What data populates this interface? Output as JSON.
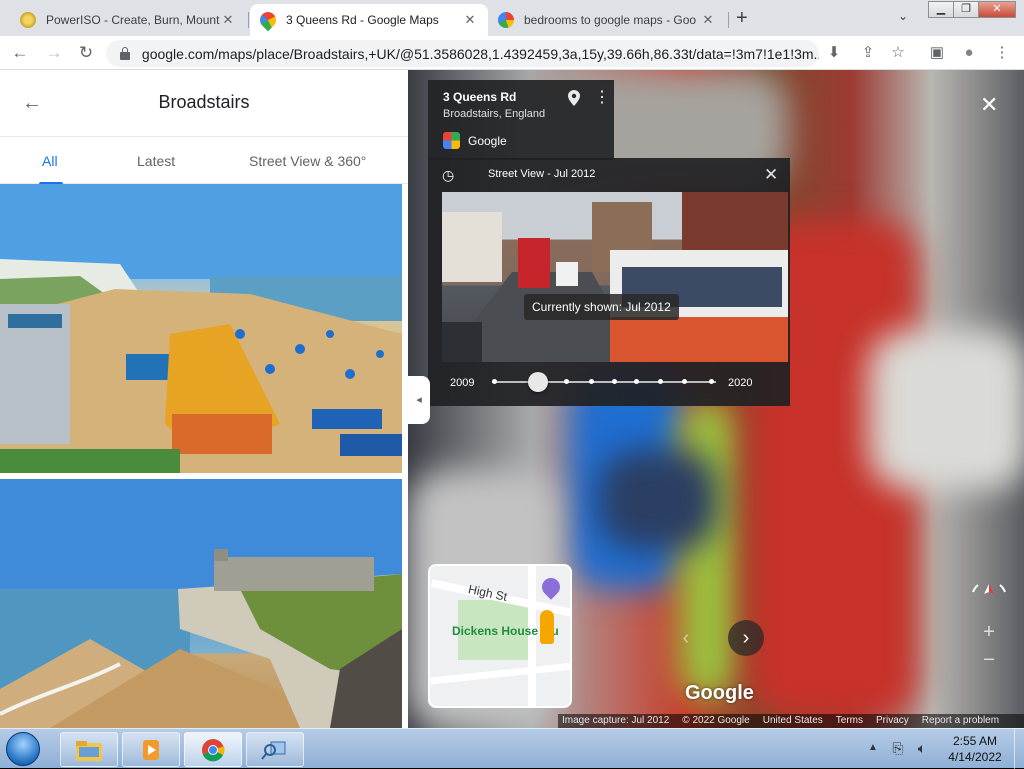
{
  "browser": {
    "tabs": [
      {
        "title": "PowerISO - Create, Burn, Mount,",
        "close": "✕"
      },
      {
        "title": "3 Queens Rd - Google Maps",
        "close": "✕"
      },
      {
        "title": "bedrooms to google maps - Goo",
        "close": "✕"
      }
    ],
    "new_tab": "+",
    "tab_menu": "⌄",
    "window_buttons": {
      "minimize": "▁",
      "maximize": "❐",
      "close": "✕"
    },
    "nav": {
      "back": "←",
      "forward": "→",
      "reload": "↻"
    },
    "url": "google.com/maps/place/Broadstairs,+UK/@51.3586028,1.4392459,3a,15y,39.66h,86.33t/data=!3m7!1e1!3m...",
    "toolbar_icons": {
      "install": "⬇",
      "share": "⇪",
      "bookmark": "☆",
      "sidepanel": "▣",
      "profile": "●",
      "menu": "⋮"
    }
  },
  "sidebar": {
    "back_icon": "←",
    "title": "Broadstairs",
    "tabs": [
      {
        "label": "All"
      },
      {
        "label": "Latest"
      },
      {
        "label": "Street View & 360°"
      }
    ]
  },
  "streetview": {
    "street": "3 Queens Rd",
    "locality": "Broadstairs, England",
    "brand": "Google",
    "close_icon": "✕",
    "collapse_icon": "◂",
    "timeline": {
      "history_icon": "◷",
      "date_label": "Street View - Jul 2012",
      "close_icon": "✕",
      "tooltip": "Currently shown: Jul 2012",
      "year_start": "2009",
      "year_end": "2020"
    },
    "minimap": {
      "street": "High St",
      "poi": "Dickens House Mu"
    },
    "nav_prev": "‹",
    "nav_next": "›",
    "zoom_in": "+",
    "zoom_out": "−",
    "watermark": "Google",
    "attribution": [
      "Image capture: Jul 2012",
      "© 2022 Google",
      "United States",
      "Terms",
      "Privacy",
      "Report a problem"
    ]
  },
  "taskbar": {
    "tray_arrow": "▲",
    "time": "2:55 AM",
    "date": "4/14/2022"
  },
  "colors": {
    "accent": "#1a73e8",
    "taskbar": "#a9c4e4"
  }
}
